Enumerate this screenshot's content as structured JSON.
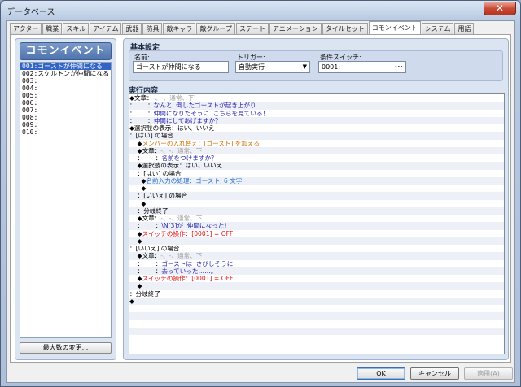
{
  "window": {
    "title": "データベース",
    "close_glyph": "✕"
  },
  "tabs": [
    {
      "label": "アクター",
      "active": false
    },
    {
      "label": "職業",
      "active": false
    },
    {
      "label": "スキル",
      "active": false
    },
    {
      "label": "アイテム",
      "active": false
    },
    {
      "label": "武器",
      "active": false
    },
    {
      "label": "防具",
      "active": false
    },
    {
      "label": "敵キャラ",
      "active": false
    },
    {
      "label": "敵グループ",
      "active": false
    },
    {
      "label": "ステート",
      "active": false
    },
    {
      "label": "アニメーション",
      "active": false
    },
    {
      "label": "タイルセット",
      "active": false
    },
    {
      "label": "コモンイベント",
      "active": true
    },
    {
      "label": "システム",
      "active": false
    },
    {
      "label": "用語",
      "active": false
    }
  ],
  "list": {
    "title": "コモンイベント",
    "items": [
      {
        "text": "001:ゴーストが仲間になる",
        "selected": true
      },
      {
        "text": "002:スケルトンが仲間になる",
        "selected": false
      },
      {
        "text": "003:",
        "selected": false
      },
      {
        "text": "004:",
        "selected": false
      },
      {
        "text": "005:",
        "selected": false
      },
      {
        "text": "006:",
        "selected": false
      },
      {
        "text": "007:",
        "selected": false
      },
      {
        "text": "008:",
        "selected": false
      },
      {
        "text": "009:",
        "selected": false
      },
      {
        "text": "010:",
        "selected": false
      }
    ],
    "max_button": "最大数の変更..."
  },
  "basic": {
    "title": "基本設定",
    "name_label": "名前:",
    "name_value": "ゴーストが仲間になる",
    "trigger_label": "トリガー:",
    "trigger_value": "自動実行",
    "switch_label": "条件スイッチ:",
    "switch_value": "0001:",
    "switch_button": "..."
  },
  "execution": {
    "title": "実行内容",
    "lines": [
      [
        {
          "t": "◆文章：",
          "c": ""
        },
        {
          "t": "-、-、通常、下",
          "c": "gray"
        }
      ],
      [
        {
          "t": "：      ：",
          "c": ""
        },
        {
          "t": "なんと  倒したゴーストが起き上がり",
          "c": "navy"
        }
      ],
      [
        {
          "t": "：      ：",
          "c": ""
        },
        {
          "t": "仲間になりたそうに  こちらを見ている！",
          "c": "navy"
        }
      ],
      [
        {
          "t": "：      ：",
          "c": ""
        },
        {
          "t": "仲間にしてあげますか？",
          "c": "navy"
        }
      ],
      [
        {
          "t": "◆選択肢の表示：はい、いいえ",
          "c": ""
        }
      ],
      [
        {
          "t": "：[はい] の場合",
          "c": ""
        }
      ],
      [
        {
          "t": "    ◆",
          "c": ""
        },
        {
          "t": "メンバーの入れ替え：[ゴースト] を加える",
          "c": "orange"
        }
      ],
      [
        {
          "t": "    ◆文章：",
          "c": ""
        },
        {
          "t": "-、-、通常、下",
          "c": "gray"
        }
      ],
      [
        {
          "t": "    ：      ：",
          "c": ""
        },
        {
          "t": "名前をつけますか？",
          "c": "navy"
        }
      ],
      [
        {
          "t": "    ◆選択肢の表示：はい、いいえ",
          "c": ""
        }
      ],
      [
        {
          "t": "    ：[はい] の場合",
          "c": ""
        }
      ],
      [
        {
          "t": "      ◆",
          "c": ""
        },
        {
          "t": "名前入力の処理：ゴースト, 6 文字",
          "c": "blue"
        }
      ],
      [
        {
          "t": "      ◆",
          "c": ""
        }
      ],
      [
        {
          "t": "    ：[いいえ] の場合",
          "c": ""
        }
      ],
      [
        {
          "t": "      ◆",
          "c": ""
        }
      ],
      [
        {
          "t": "    ：分岐終了",
          "c": ""
        }
      ],
      [
        {
          "t": "    ◆文章：",
          "c": ""
        },
        {
          "t": "-、-、通常、下",
          "c": "gray"
        }
      ],
      [
        {
          "t": "    ：      ：",
          "c": ""
        },
        {
          "t": "\\N[3]が  仲間になった！",
          "c": "navy"
        }
      ],
      [
        {
          "t": "    ◆",
          "c": ""
        },
        {
          "t": "スイッチの操作：[0001] = OFF",
          "c": "red"
        }
      ],
      [
        {
          "t": "    ◆",
          "c": ""
        }
      ],
      [
        {
          "t": "：[いいえ] の場合",
          "c": ""
        }
      ],
      [
        {
          "t": "    ◆文章：",
          "c": ""
        },
        {
          "t": "-、-、通常、下",
          "c": "gray"
        }
      ],
      [
        {
          "t": "    ：      ：",
          "c": ""
        },
        {
          "t": "ゴーストは  さびしそうに",
          "c": "navy"
        }
      ],
      [
        {
          "t": "    ：      ：",
          "c": ""
        },
        {
          "t": "去っていった……。",
          "c": "navy"
        }
      ],
      [
        {
          "t": "    ◆",
          "c": ""
        },
        {
          "t": "スイッチの操作：[0001] = OFF",
          "c": "red"
        }
      ],
      [
        {
          "t": "    ◆",
          "c": ""
        }
      ],
      [
        {
          "t": "：分岐終了",
          "c": ""
        }
      ],
      [
        {
          "t": "◆",
          "c": ""
        }
      ],
      [],
      [],
      [],
      [],
      []
    ]
  },
  "footer": {
    "ok": "OK",
    "cancel": "キャンセル",
    "apply": "適用(A)"
  },
  "colors": {
    "selection": "#3264c8",
    "text_gray": "#a0a0a0",
    "text_navy": "#2020b0",
    "text_orange": "#d07000",
    "text_red": "#e01010",
    "text_blue": "#2070d0"
  }
}
